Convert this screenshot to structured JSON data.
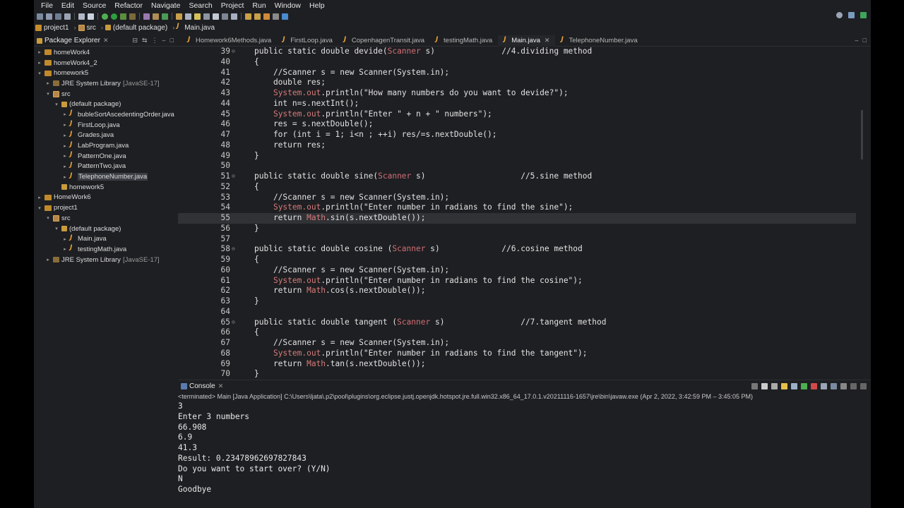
{
  "menu": [
    "File",
    "Edit",
    "Source",
    "Refactor",
    "Navigate",
    "Search",
    "Project",
    "Run",
    "Window",
    "Help"
  ],
  "breadcrumb": [
    "project1",
    "src",
    "(default package)",
    "Main.java"
  ],
  "package_explorer": {
    "title": "Package Explorer",
    "items": [
      {
        "label": "homeWork4",
        "icon": "project-icon",
        "arrow": "▸"
      },
      {
        "label": "homeWork4_2",
        "icon": "project-icon",
        "arrow": "▸"
      },
      {
        "label": "homework5",
        "icon": "project-icon",
        "arrow": "▾"
      },
      {
        "label": "JRE System Library",
        "extra": "[JavaSE-17]",
        "icon": "library-icon",
        "arrow": "▸"
      },
      {
        "label": "src",
        "icon": "folder-icon",
        "arrow": "▾"
      },
      {
        "label": "(default package)",
        "icon": "package-icon",
        "arrow": "▾"
      },
      {
        "label": "bubleSortAscedentingOrder.java",
        "icon": "java-file-icon",
        "arrow": "▸"
      },
      {
        "label": "FirstLoop.java",
        "icon": "java-file-icon",
        "arrow": "▸"
      },
      {
        "label": "Grades.java",
        "icon": "java-file-icon",
        "arrow": "▸"
      },
      {
        "label": "LabProgram.java",
        "icon": "java-file-icon",
        "arrow": "▸"
      },
      {
        "label": "PatternOne.java",
        "icon": "java-file-icon",
        "arrow": "▸"
      },
      {
        "label": "PatternTwo.java",
        "icon": "java-file-icon",
        "arrow": "▸"
      },
      {
        "label": "TelephoneNumber.java",
        "icon": "java-file-icon",
        "arrow": "▸",
        "selected": true
      },
      {
        "label": "homework5",
        "icon": "package-icon",
        "arrow": ""
      },
      {
        "label": "HomeWork6",
        "icon": "project-icon",
        "arrow": "▸"
      },
      {
        "label": "project1",
        "icon": "project-icon",
        "arrow": "▾"
      },
      {
        "label": "src",
        "icon": "folder-icon",
        "arrow": "▾"
      },
      {
        "label": "(default package)",
        "icon": "package-icon",
        "arrow": "▾"
      },
      {
        "label": "Main.java",
        "icon": "java-file-icon",
        "arrow": "▸"
      },
      {
        "label": "testingMath.java",
        "icon": "java-file-icon",
        "arrow": "▸"
      },
      {
        "label": "JRE System Library",
        "extra": "[JavaSE-17]",
        "icon": "library-icon",
        "arrow": "▸"
      }
    ]
  },
  "editor_tabs": [
    {
      "label": "Homework6Methods.java",
      "active": false
    },
    {
      "label": "FirstLoop.java",
      "active": false
    },
    {
      "label": "CopenhagenTransit.java",
      "active": false
    },
    {
      "label": "testingMath.java",
      "active": false
    },
    {
      "label": "Main.java",
      "active": true
    },
    {
      "label": "TelephoneNumber.java",
      "active": false
    }
  ],
  "code_lines": [
    {
      "n": "39",
      "fold": "⊖",
      "text": "public static double devide(Scanner s)              //4.dividing method"
    },
    {
      "n": "40",
      "text": "{"
    },
    {
      "n": "41",
      "text": "    //Scanner s = new Scanner(System.in);"
    },
    {
      "n": "42",
      "text": "    double res;"
    },
    {
      "n": "43",
      "text": "    System.out.println(\"How many numbers do you want to devide?\");"
    },
    {
      "n": "44",
      "text": "    int n=s.nextInt();"
    },
    {
      "n": "45",
      "text": "    System.out.println(\"Enter \" + n + \" numbers\");"
    },
    {
      "n": "46",
      "text": "    res = s.nextDouble();"
    },
    {
      "n": "47",
      "text": "    for (int i = 1; i<n ; ++i) res/=s.nextDouble();"
    },
    {
      "n": "48",
      "text": "    return res;"
    },
    {
      "n": "49",
      "text": "}"
    },
    {
      "n": "50",
      "text": ""
    },
    {
      "n": "51",
      "fold": "⊖",
      "text": "public static double sine(Scanner s)                    //5.sine method"
    },
    {
      "n": "52",
      "text": "{"
    },
    {
      "n": "53",
      "text": "    //Scanner s = new Scanner(System.in);"
    },
    {
      "n": "54",
      "text": "    System.out.println(\"Enter number in radians to find the sine\");"
    },
    {
      "n": "55",
      "text": "    return Math.sin(s.nextDouble());",
      "highlight": true
    },
    {
      "n": "56",
      "text": "}"
    },
    {
      "n": "57",
      "text": ""
    },
    {
      "n": "58",
      "fold": "⊖",
      "text": "public static double cosine (Scanner s)             //6.cosine method"
    },
    {
      "n": "59",
      "text": "{"
    },
    {
      "n": "60",
      "text": "    //Scanner s = new Scanner(System.in);"
    },
    {
      "n": "61",
      "text": "    System.out.println(\"Enter number in radians to find the cosine\");"
    },
    {
      "n": "62",
      "text": "    return Math.cos(s.nextDouble());"
    },
    {
      "n": "63",
      "text": "}"
    },
    {
      "n": "64",
      "text": ""
    },
    {
      "n": "65",
      "fold": "⊖",
      "text": "public static double tangent (Scanner s)                //7.tangent method"
    },
    {
      "n": "66",
      "text": "{"
    },
    {
      "n": "67",
      "text": "    //Scanner s = new Scanner(System.in);"
    },
    {
      "n": "68",
      "text": "    System.out.println(\"Enter number in radians to find the tangent\");"
    },
    {
      "n": "69",
      "text": "    return Math.tan(s.nextDouble());"
    },
    {
      "n": "70",
      "text": "}"
    }
  ],
  "console": {
    "title": "Console",
    "status": "<terminated> Main [Java Application] C:\\Users\\ljata\\.p2\\pool\\plugins\\org.eclipse.justj.openjdk.hotspot.jre.full.win32.x86_64_17.0.1.v20211116-1657\\jre\\bin\\javaw.exe  (Apr 2, 2022, 3:42:59 PM – 3:45:05 PM)",
    "lines": [
      "3",
      "Enter 3 numbers",
      "66.908",
      "6.9",
      "41.3",
      "Result: 0.23478962697827843",
      "Do you want to start over? (Y/N)",
      "N",
      "Goodbye"
    ]
  },
  "colors": {
    "background": "#1e1f22",
    "system_out": "#d67a7a",
    "selection": "#2a5a8a",
    "line_highlight": "#303236"
  }
}
